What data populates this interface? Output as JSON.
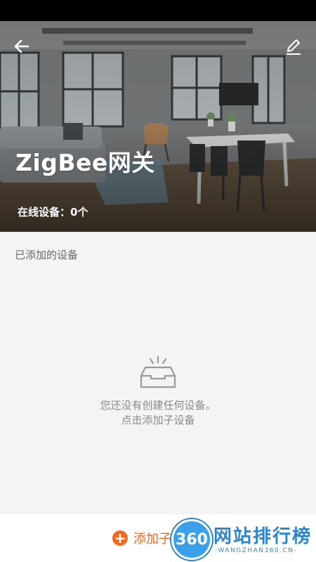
{
  "header": {
    "title": "ZigBee网关",
    "online_devices": "在线设备：0个",
    "back_icon": "back-arrow-icon",
    "edit_icon": "pencil-icon"
  },
  "section": {
    "label": "已添加的设备"
  },
  "empty_state": {
    "icon": "empty-tray-icon",
    "line1": "您还没有创建任何设备。",
    "line2": "点击添加子设备"
  },
  "bottom": {
    "add_label": "添加子",
    "accent": "#f06a25"
  },
  "watermark": {
    "badge": "360",
    "text": "网站排行榜",
    "sub": "-WANGZHAN360.CN-"
  }
}
